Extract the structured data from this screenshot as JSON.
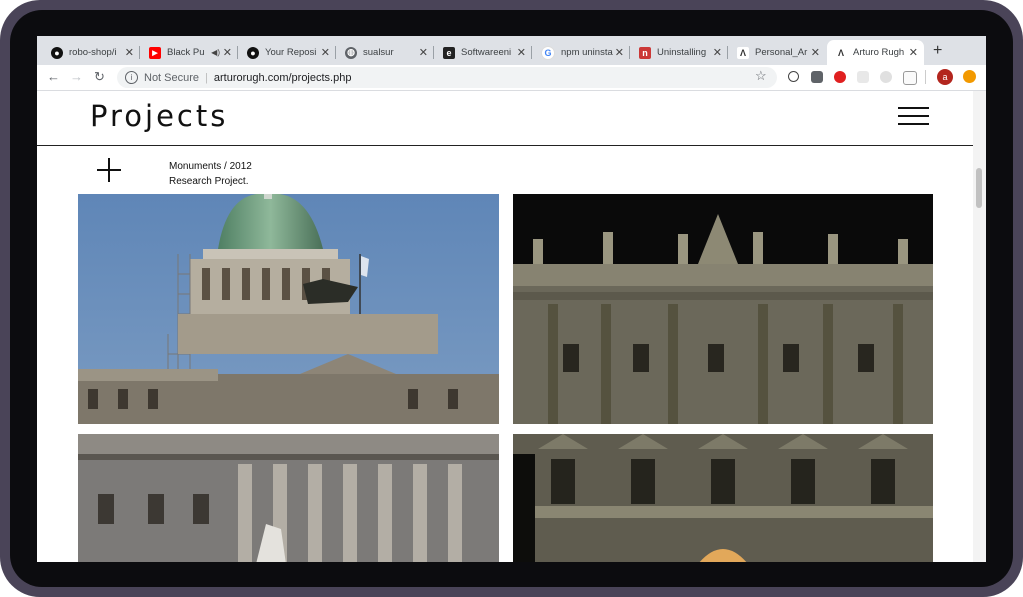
{
  "browser": {
    "tabs": [
      {
        "title": "robo-shop/i",
        "icon": "github-icon",
        "color": "#111111"
      },
      {
        "title": "Black Pu",
        "icon": "youtube-icon",
        "color": "#ff0000",
        "audio": "◀)"
      },
      {
        "title": "Your Reposi",
        "icon": "github-icon",
        "color": "#111111"
      },
      {
        "title": "sualsur",
        "icon": "globe-icon",
        "color": "#5f6368"
      },
      {
        "title": "Softwareeni",
        "icon": "elephant-icon",
        "color": "#222222"
      },
      {
        "title": "npm uninsta",
        "icon": "google-icon",
        "color": "#4285f4"
      },
      {
        "title": "Uninstalling",
        "icon": "npm-icon",
        "color": "#cb3837"
      },
      {
        "title": "Personal_Ar",
        "icon": "arturo-icon",
        "color": "#333333"
      },
      {
        "title": "Arturo Rugh",
        "icon": "arturo-icon",
        "color": "#333333",
        "active": true
      }
    ],
    "address": {
      "security": "Not Secure",
      "url": "arturorugh.com/projects.php"
    },
    "profile_initial": "a"
  },
  "site": {
    "title": "Projects",
    "project": {
      "name_year": "Monuments / 2012",
      "description": "Research Project."
    }
  },
  "colors": {
    "sky": "#6a8fbf",
    "night": "#0a0a0a",
    "stone_day": "#a8a49c",
    "stone_night": "#6d6a5c",
    "dome": "#6fa07e"
  }
}
